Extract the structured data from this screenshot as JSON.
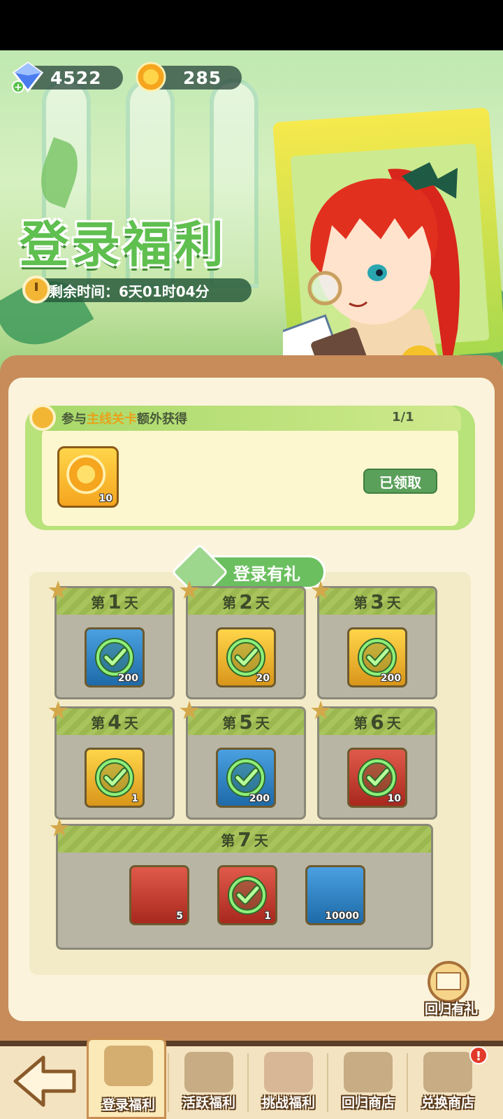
{
  "currencies": {
    "gems": {
      "value": "4522",
      "icon": "gem-icon"
    },
    "gold": {
      "value": "285",
      "icon": "sun-coin-icon"
    }
  },
  "banner": {
    "title": "登录福利",
    "timer": "剩余时间：6天01时04分"
  },
  "extra_reward": {
    "label_prefix": "参与",
    "label_highlight": "主线关卡",
    "label_suffix": "额外获得",
    "progress": "1/1",
    "item_count": "10",
    "status": "已领取"
  },
  "login_gift": {
    "title": "登录有礼",
    "day_prefix": "第",
    "day_suffix": "天",
    "days": [
      {
        "day": "1",
        "item_color": "blue",
        "count": "200",
        "claimed": true
      },
      {
        "day": "2",
        "item_color": "gold",
        "count": "20",
        "claimed": true
      },
      {
        "day": "3",
        "item_color": "gold",
        "count": "200",
        "claimed": true
      },
      {
        "day": "4",
        "item_color": "gold",
        "count": "1",
        "claimed": true
      },
      {
        "day": "5",
        "item_color": "blue",
        "count": "200",
        "claimed": true
      },
      {
        "day": "6",
        "item_color": "red",
        "count": "10",
        "claimed": true
      }
    ],
    "day7": {
      "day": "7",
      "items": [
        {
          "item_color": "red",
          "count": "5",
          "claimed": false
        },
        {
          "item_color": "red",
          "count": "1",
          "claimed": true
        },
        {
          "item_color": "blue",
          "count": "10000",
          "claimed": false
        }
      ]
    }
  },
  "return_gift": {
    "label": "回归有礼",
    "icon": "envelope-icon"
  },
  "nav": {
    "back_icon": "back-arrow-icon",
    "items": [
      {
        "label": "登录福利",
        "active": true
      },
      {
        "label": "活跃福利",
        "active": false
      },
      {
        "label": "挑战福利",
        "active": false
      },
      {
        "label": "回归商店",
        "active": false
      },
      {
        "label": "兑换商店",
        "active": false,
        "badge": "!"
      }
    ]
  },
  "colors": {
    "accent_green": "#6bbf5f",
    "panel_bg": "#fbf3dc",
    "frame_brown": "#c78c5a"
  }
}
